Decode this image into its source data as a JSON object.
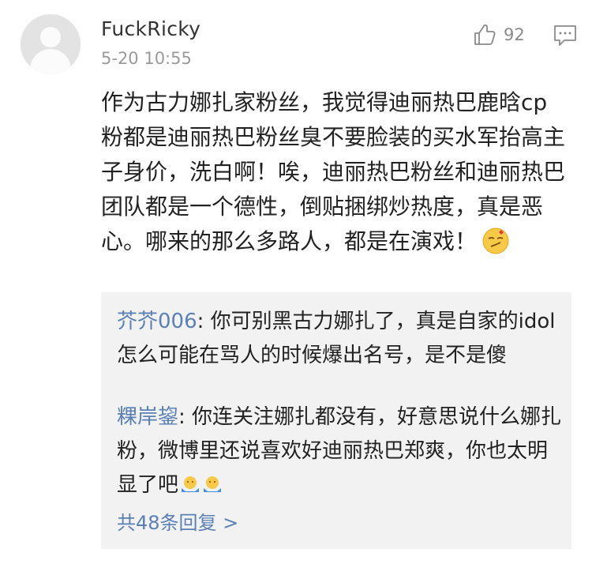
{
  "comment": {
    "username": "FuckRicky",
    "timestamp": "5-20 10:55",
    "likes": "92",
    "icons": {
      "avatar": "default-avatar",
      "like": "thumbs-up-icon",
      "reply": "comment-bubble-icon",
      "emoji": "smirk-emoji-icon"
    },
    "text": "作为古力娜扎家粉丝，我觉得迪丽热巴鹿晗cp粉都是迪丽热巴粉丝臭不要脸装的买水军抬高主子身价，洗白啊！唉，迪丽热巴粉丝和迪丽热巴团队都是一个德性，倒贴捆绑炒热度，真是恶心。哪来的那么多路人，都是在演戏！"
  },
  "replies": [
    {
      "name": "芥芥006",
      "separator": ": ",
      "text": "你可别黑古力娜扎了，真是自家的idol怎么可能在骂人的时候爆出名号，是不是傻"
    },
    {
      "name": "粿岸鋆",
      "separator": ": ",
      "text": "你连关注娜扎都没有，好意思说什么娜扎粉，微博里还说喜欢好迪丽热巴郑爽，你也太明显了吧",
      "emoji": "shrug-emoji-icon"
    }
  ],
  "more_replies": "共48条回复 >",
  "colors": {
    "link": "#5b80b5",
    "reply_bg": "#f2f2f2",
    "meta": "#9a9a9a"
  }
}
